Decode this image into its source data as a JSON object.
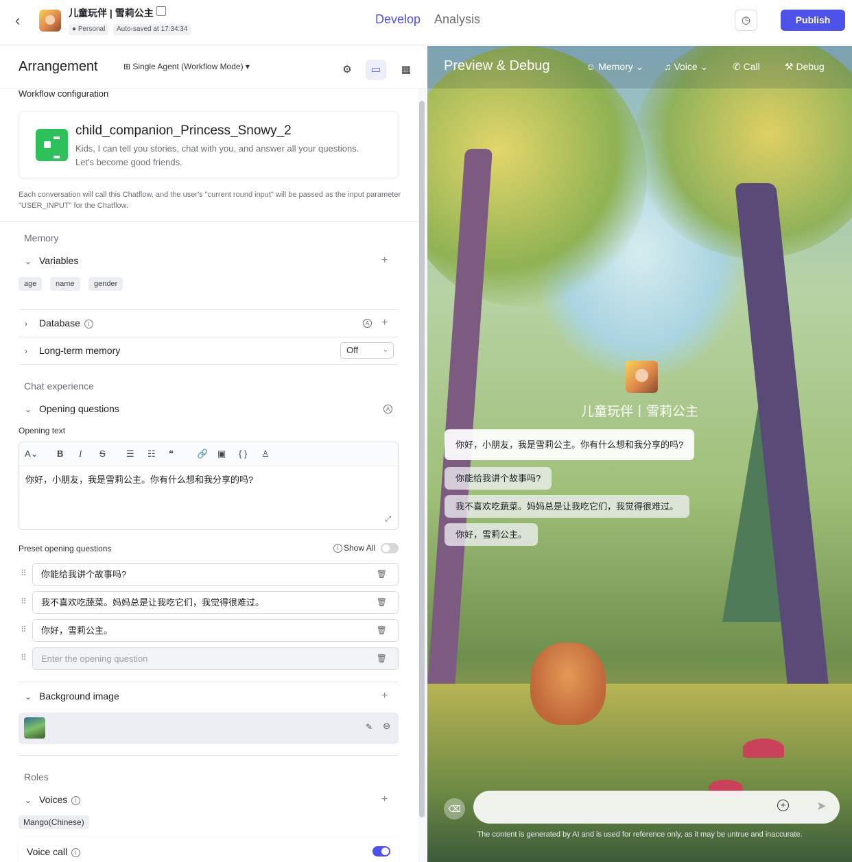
{
  "topbar": {
    "app_title": "儿童玩伴 | 雪莉公主",
    "tag_personal": "Personal",
    "tag_autosave": "Auto-saved at 17:34:34",
    "tabs": [
      {
        "label": "Develop",
        "active": true
      },
      {
        "label": "Analysis",
        "active": false
      }
    ],
    "publish_label": "Publish"
  },
  "arrangement": {
    "title": "Arrangement",
    "mode": "Single Agent (Workflow Mode)",
    "workflow_label": "Workflow configuration",
    "workflow_name": "child_companion_Princess_Snowy_2",
    "workflow_desc": "Kids, I can tell you stories, chat with you, and answer all your questions. Let's become good friends.",
    "workflow_note": "Each conversation will call this Chatflow, and the user's \"current round input\" will be passed as the input parameter \"USER_INPUT\" for the Chatflow."
  },
  "memory": {
    "section": "Memory",
    "variables_label": "Variables",
    "variables": [
      "age",
      "name",
      "gender"
    ],
    "database_label": "Database",
    "longterm_label": "Long-term memory",
    "longterm_value": "Off"
  },
  "chat_experience": {
    "section": "Chat experience",
    "opening_label": "Opening questions",
    "opening_text_label": "Opening text",
    "opening_text": "你好，小朋友，我是雪莉公主。你有什么想和我分享的吗?",
    "preset_label": "Preset opening questions",
    "show_all_label": "Show All",
    "show_all_enabled": false,
    "questions": [
      "你能给我讲个故事吗?",
      "我不喜欢吃蔬菜。妈妈总是让我吃它们，我觉得很难过。",
      "你好，雪莉公主。"
    ],
    "question_placeholder": "Enter the opening question",
    "background_label": "Background image"
  },
  "roles": {
    "section": "Roles",
    "voices_label": "Voices",
    "voice_chip": "Mango(Chinese)",
    "voice_call_label": "Voice call",
    "voice_call_enabled": true
  },
  "preview": {
    "title": "Preview & Debug",
    "menu": [
      "Memory",
      "Voice",
      "Call",
      "Debug"
    ],
    "bot_name": "儿童玩伴丨雪莉公主",
    "opening_message": "你好，小朋友，我是雪莉公主。你有什么想和我分享的吗?",
    "suggestions": [
      "你能给我讲个故事吗?",
      "我不喜欢吃蔬菜。妈妈总是让我吃它们，我觉得很难过。",
      "你好，雪莉公主。"
    ],
    "disclaimer": "The content is generated by AI and is used for reference only, as it may be untrue and inaccurate."
  },
  "colors": {
    "accent": "#4d53e8",
    "workflow_icon": "#2ec05a"
  },
  "icons": [
    "back-icon",
    "edit-icon",
    "history-icon",
    "workflow-icon",
    "info-icon",
    "plus-icon",
    "trash-icon",
    "drag-handle-icon",
    "send-icon",
    "clear-chat-icon"
  ]
}
